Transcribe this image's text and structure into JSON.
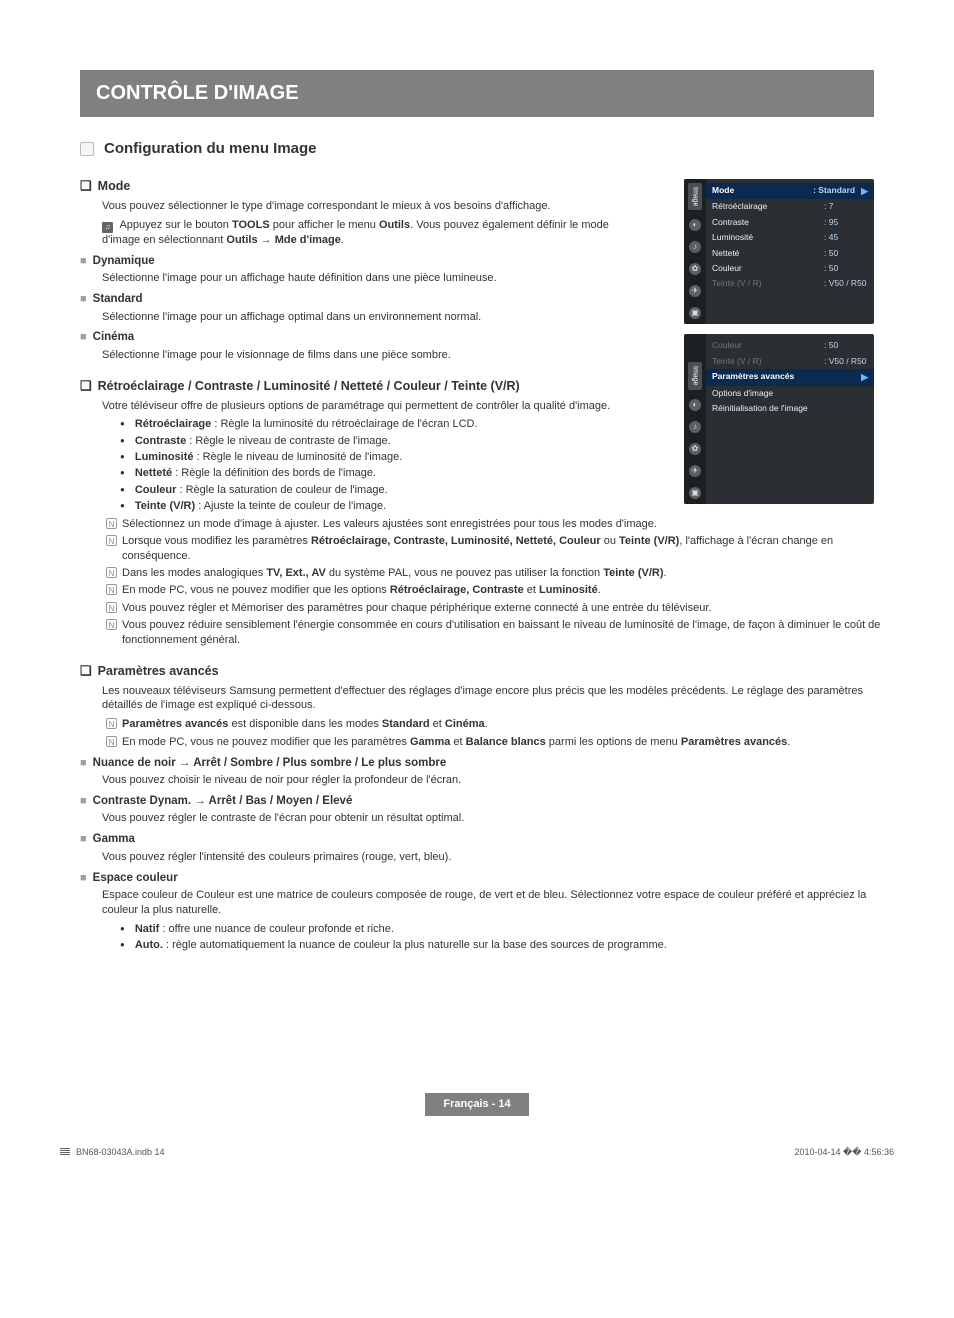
{
  "title_bar": "CONTRÔLE D'IMAGE",
  "section_title": "Configuration du menu Image",
  "mode": {
    "heading": "Mode",
    "intro": "Vous pouvez sélectionner le type d'image correspondant le mieux à vos besoins d'affichage.",
    "tools_pre": "Appuyez sur le bouton ",
    "tools_b1": "TOOLS",
    "tools_mid": " pour afficher le menu ",
    "tools_b2": "Outils",
    "tools_post": ". Vous pouvez également définir le mode d'image en sélectionnant ",
    "tools_b3": "Outils",
    "tools_arrow": " → ",
    "tools_b4": "Mde d'image",
    "tools_end": ".",
    "dyn_h": "Dynamique",
    "dyn_t": "Sélectionne l'image pour un affichage haute définition dans une pièce lumineuse.",
    "std_h": "Standard",
    "std_t": "Sélectionne l'image pour un affichage optimal dans un environnement normal.",
    "cin_h": "Cinéma",
    "cin_t": "Sélectionne l'image pour le visionnage de films dans une pièce sombre."
  },
  "retro": {
    "heading": "Rétroéclairage / Contraste / Luminosité / Netteté / Couleur / Teinte (V/R)",
    "intro": "Votre téléviseur offre de plusieurs options de paramétrage qui permettent de contrôler la qualité d'image.",
    "b1_l": "Rétroéclairage",
    "b1_t": " : Règle la luminosité du rétroéclairage de l'écran LCD.",
    "b2_l": "Contraste",
    "b2_t": " : Règle le niveau de contraste de l'image.",
    "b3_l": "Luminosité",
    "b3_t": " : Règle le niveau de luminosité de l'image.",
    "b4_l": "Netteté",
    "b4_t": " : Règle la définition des bords de l'image.",
    "b5_l": "Couleur",
    "b5_t": " : Règle la saturation de couleur de l'image.",
    "b6_l": "Teinte (V/R)",
    "b6_t": " : Ajuste la teinte de couleur de l'image.",
    "n1": "Sélectionnez un mode d'image à ajuster. Les valeurs ajustées sont enregistrées pour tous les modes d'image.",
    "n2_pre": "Lorsque vous modifiez les paramètres ",
    "n2_b": "Rétroéclairage, Contraste, Luminosité, Netteté, Couleur",
    "n2_mid": " ou ",
    "n2_b2": "Teinte (V/R)",
    "n2_post": ", l'affichage à l'écran change en conséquence.",
    "n3_pre": "Dans les modes analogiques ",
    "n3_b": "TV, Ext., AV",
    "n3_mid": " du système PAL, vous ne pouvez pas utiliser la fonction ",
    "n3_b2": "Teinte (V/R)",
    "n3_post": ".",
    "n4_pre": "En mode PC, vous ne pouvez modifier que les options ",
    "n4_b": "Rétroéclairage, Contraste",
    "n4_mid": " et ",
    "n4_b2": "Luminosité",
    "n4_post": ".",
    "n5": "Vous pouvez régler et Mémoriser des paramètres pour chaque périphérique externe connecté à une entrée du téléviseur.",
    "n6": "Vous pouvez réduire sensiblement l'énergie consommée en cours d'utilisation en baissant le niveau de luminosité de l'image, de façon à diminuer le coût de fonctionnement général."
  },
  "adv": {
    "heading": "Paramètres avancés",
    "intro": "Les nouveaux téléviseurs Samsung permettent d'effectuer des réglages d'image encore plus précis que les modèles précédents. Le réglage des paramètres détaillés de l'image est expliqué ci-dessous.",
    "n1_b": "Paramètres avancés",
    "n1_t": " est disponible dans les modes ",
    "n1_b2": "Standard",
    "n1_mid": " et ",
    "n1_b3": "Cinéma",
    "n1_post": ".",
    "n2_pre": "En mode PC, vous ne pouvez modifier que les paramètres ",
    "n2_b": "Gamma",
    "n2_mid": " et ",
    "n2_b2": "Balance blancs",
    "n2_post": " parmi les options de menu ",
    "n2_b3": "Paramètres avancés",
    "n2_end": ".",
    "nua_h": "Nuance de noir → Arrêt / Sombre / Plus sombre / Le plus sombre",
    "nua_t": "Vous pouvez choisir le niveau de noir pour régler la profondeur de l'écran.",
    "con_h": "Contraste Dynam. → Arrêt / Bas / Moyen / Elevé",
    "con_t": "Vous pouvez régler le contraste de l'écran pour obtenir un résultat optimal.",
    "gam_h": "Gamma",
    "gam_t": "Vous pouvez régler l'intensité des couleurs primaires (rouge, vert, bleu).",
    "esp_h": "Espace couleur",
    "esp_t": "Espace couleur de Couleur est une matrice de couleurs composée de rouge, de vert et de bleu. Sélectionnez votre espace de couleur préféré et appréciez la couleur la plus naturelle.",
    "esp_b1_l": "Natif",
    "esp_b1_t": " : offre une nuance de couleur profonde et riche.",
    "esp_b2_l": "Auto.",
    "esp_b2_t": " : règle automatiquement la nuance de couleur la plus naturelle sur la base des sources de programme."
  },
  "osd1": {
    "tab": "Image",
    "rows": [
      {
        "l": "Mode",
        "v": ": Standard",
        "hi": true,
        "arrow": "▶"
      },
      {
        "l": "Rétroéclairage",
        "v": ": 7"
      },
      {
        "l": "Contraste",
        "v": ": 95"
      },
      {
        "l": "Luminosité",
        "v": ": 45"
      },
      {
        "l": "Netteté",
        "v": ": 50"
      },
      {
        "l": "Couleur",
        "v": ": 50"
      },
      {
        "l": "Teinte (V / R)",
        "v": ": V50 / R50",
        "dim": true
      }
    ]
  },
  "osd2": {
    "tab": "Image",
    "top": [
      {
        "l": "Couleur",
        "v": ": 50",
        "dim": true
      },
      {
        "l": "Teinte (V / R)",
        "v": ": V50 / R50",
        "dim": true
      }
    ],
    "rows": [
      {
        "l": "Paramètres avancés",
        "v": "",
        "hi": true,
        "arrow": "▶"
      },
      {
        "l": "Options d'image",
        "v": ""
      },
      {
        "l": "Réinitialisation de l'image",
        "v": ""
      }
    ]
  },
  "footer": "Français - 14",
  "part_no": "BN68-03043A.indb   14",
  "print_ts": "2010-04-14   �� 4:56:36"
}
